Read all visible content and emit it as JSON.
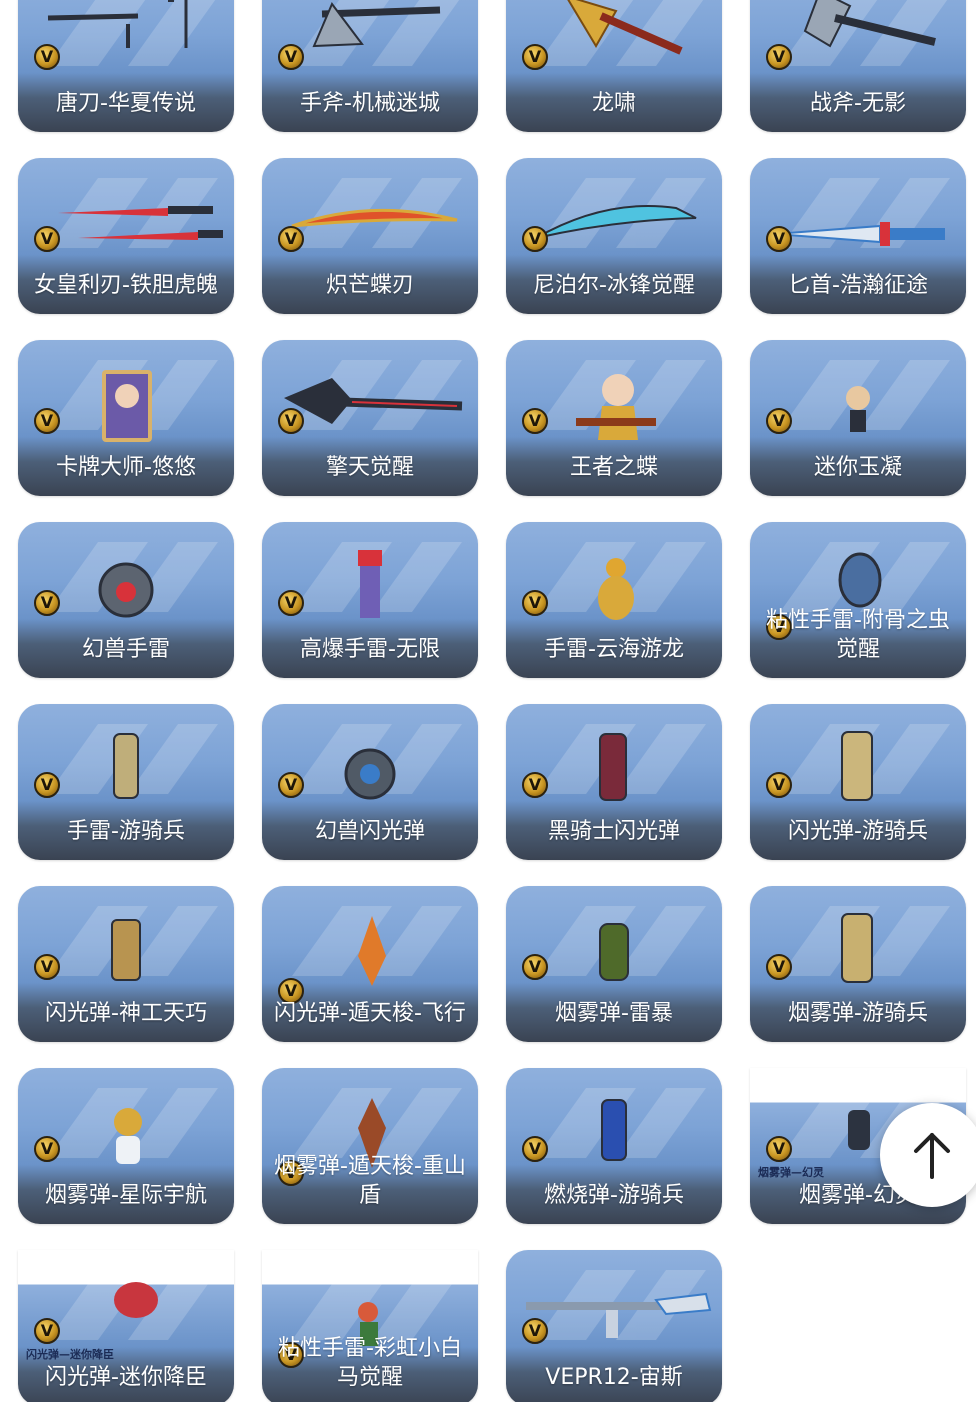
{
  "badge_letter": "V",
  "items": [
    {
      "label": "唐刀-华夏传说",
      "icon": "tang-sword"
    },
    {
      "label": "手斧-机械迷城",
      "icon": "hand-axe"
    },
    {
      "label": "龙啸",
      "icon": "golden-axe"
    },
    {
      "label": "战斧-无影",
      "icon": "battle-axe"
    },
    {
      "label": "女皇利刃-铁胆虎魄",
      "icon": "twin-red-blades"
    },
    {
      "label": "炽芒蝶刃",
      "icon": "flame-butterfly-blade"
    },
    {
      "label": "尼泊尔-冰锋觉醒",
      "icon": "ice-kukri"
    },
    {
      "label": "匕首-浩瀚征途",
      "icon": "dagger"
    },
    {
      "label": "卡牌大师-悠悠",
      "icon": "character-card"
    },
    {
      "label": "擎天觉醒",
      "icon": "shovel-blade"
    },
    {
      "label": "王者之蝶",
      "icon": "butterfly-girl-figure"
    },
    {
      "label": "迷你玉凝",
      "icon": "mini-figure"
    },
    {
      "label": "幻兽手雷",
      "icon": "beast-grenade"
    },
    {
      "label": "高爆手雷-无限",
      "icon": "canister-grenade"
    },
    {
      "label": "手雷-云海游龙",
      "icon": "dragon-grenade"
    },
    {
      "label": "粘性手雷-附骨之虫觉醒",
      "icon": "bug-grenade"
    },
    {
      "label": "手雷-游骑兵",
      "icon": "ranger-grenade"
    },
    {
      "label": "幻兽闪光弹",
      "icon": "beast-flashbang"
    },
    {
      "label": "黑骑士闪光弹",
      "icon": "dark-knight-flashbang"
    },
    {
      "label": "闪光弹-游骑兵",
      "icon": "ranger-flashbang"
    },
    {
      "label": "闪光弹-神工天巧",
      "icon": "crafted-flashbang"
    },
    {
      "label": "闪光弹-遁天梭-飞行",
      "icon": "shuttle-flashbang"
    },
    {
      "label": "烟雾弹-雷暴",
      "icon": "thunder-smoke"
    },
    {
      "label": "烟雾弹-游骑兵",
      "icon": "ranger-smoke"
    },
    {
      "label": "烟雾弹-星际宇航",
      "icon": "astronaut-smoke"
    },
    {
      "label": "烟雾弹-遁天梭-重山盾",
      "icon": "shield-smoke"
    },
    {
      "label": "燃烧弹-游骑兵",
      "icon": "ranger-molotov"
    },
    {
      "label": "烟雾弹-幻灵",
      "icon": "spirit-smoke",
      "inner_title": "烟雾弹—幻灵",
      "style": "short"
    },
    {
      "label": "闪光弹-迷你降臣",
      "icon": "mini-car-flashbang",
      "inner_title": "闪光弹—迷你降臣",
      "style": "short"
    },
    {
      "label": "粘性手雷-彩虹小白马觉醒",
      "icon": "rainbow-pony-grenade",
      "style": "short"
    },
    {
      "label": "VEPR12-宙斯",
      "icon": "shotgun"
    }
  ],
  "scroll_top": {
    "icon": "arrow-up-icon"
  },
  "colors": {
    "card_top": "#8fb0dd",
    "card_bottom": "#3a4352",
    "badge_gold": "#c89522"
  }
}
